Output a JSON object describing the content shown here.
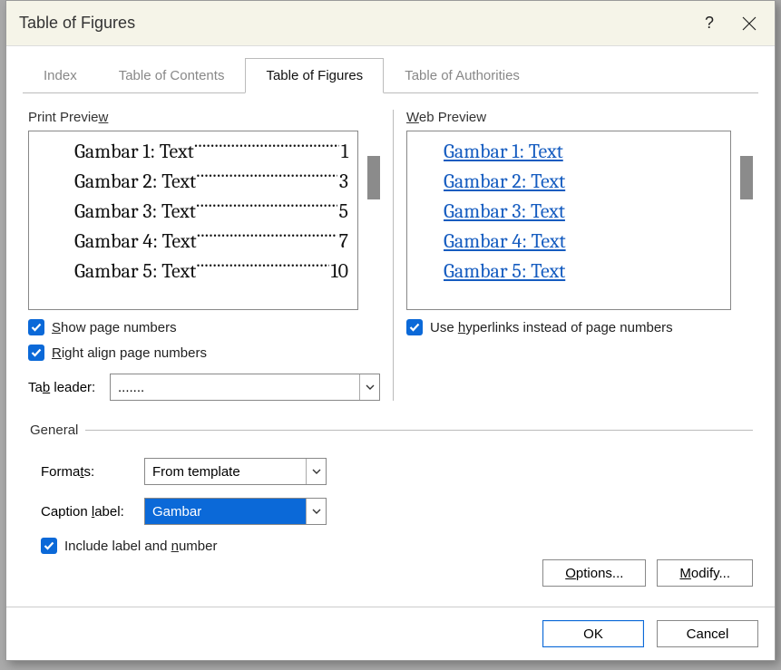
{
  "dialog": {
    "title": "Table of Figures"
  },
  "tabs": {
    "index": "Index",
    "toc": "Table of Contents",
    "tof": "Table of Figures",
    "toa": "Table of Authorities"
  },
  "preview": {
    "print_label": "Print Preview",
    "web_label": "Web Preview",
    "print_items": [
      {
        "label": "Gambar 1: Text",
        "page": "1"
      },
      {
        "label": "Gambar 2: Text",
        "page": "3"
      },
      {
        "label": "Gambar 3: Text",
        "page": "5"
      },
      {
        "label": "Gambar 4: Text",
        "page": "7"
      },
      {
        "label": "Gambar 5: Text",
        "page": "10"
      }
    ],
    "web_items": [
      "Gambar 1: Text",
      "Gambar 2: Text",
      "Gambar 3: Text",
      "Gambar 4: Text",
      "Gambar 5: Text"
    ]
  },
  "options": {
    "show_page_numbers": "Show page numbers",
    "right_align": "Right align page numbers",
    "use_hyperlinks": "Use hyperlinks instead of page numbers",
    "tab_leader_label": "Tab leader:",
    "tab_leader_value": "......."
  },
  "general": {
    "legend": "General",
    "formats_label": "Formats:",
    "formats_value": "From template",
    "caption_label": "Caption label:",
    "caption_value": "Gambar",
    "include_label": "Include label and number"
  },
  "buttons": {
    "options": "Options...",
    "modify": "Modify...",
    "ok": "OK",
    "cancel": "Cancel"
  }
}
